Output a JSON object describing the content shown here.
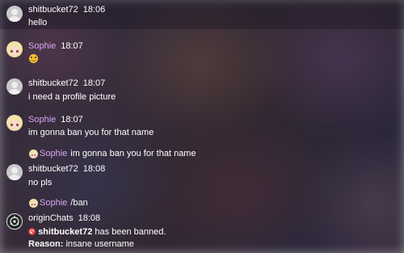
{
  "messages": [
    {
      "username": "shitbucket72",
      "time": "18:06",
      "text": "hello"
    },
    {
      "username": "Sophie",
      "time": "18:07",
      "emoji": "grinning-emoji"
    },
    {
      "username": "shitbucket72",
      "time": "18:07",
      "text": "i need a profile picture"
    },
    {
      "username": "Sophie",
      "time": "18:07",
      "text": "im gonna ban you for that name"
    },
    {
      "reply_username": "Sophie",
      "reply_text": "im gonna ban you for that name"
    },
    {
      "username": "shitbucket72",
      "time": "18:08",
      "text": "no pls"
    },
    {
      "reply_username": "Sophie",
      "reply_text": "/ban"
    },
    {
      "username": "originChats",
      "time": "18:08",
      "banned_user": "shitbucket72",
      "ban_text": " has been banned.",
      "reason_label": "Reason:",
      "reason_text": " insane username"
    }
  ],
  "colors": {
    "sophie_name": "#d9a8f1",
    "ban_icon": "#e23b3b"
  }
}
